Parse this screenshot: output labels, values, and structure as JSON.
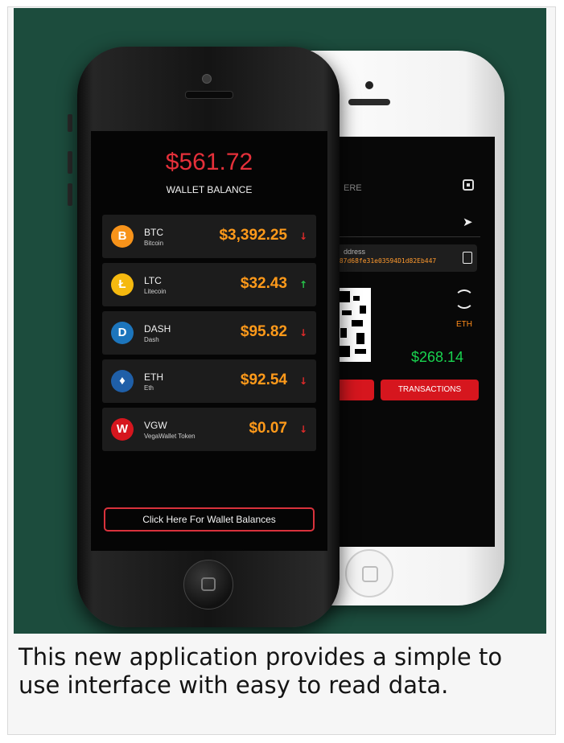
{
  "caption": "This new application provides a simple to use interface with easy to read data.",
  "front_phone": {
    "balance": "$561.72",
    "balance_label": "WALLET BALANCE",
    "coins": [
      {
        "symbol": "BTC",
        "name": "Bitcoin",
        "price": "$3,392.25",
        "trend": "↓",
        "direction": "down",
        "icon": "bitcoin-icon",
        "color": "#f7931a",
        "glyph": "B"
      },
      {
        "symbol": "LTC",
        "name": "Litecoin",
        "price": "$32.43",
        "trend": "↑",
        "direction": "up",
        "icon": "litecoin-icon",
        "color": "#f5b90f",
        "glyph": "Ł"
      },
      {
        "symbol": "DASH",
        "name": "Dash",
        "price": "$95.82",
        "trend": "↓",
        "direction": "down",
        "icon": "dash-icon",
        "color": "#1c75bc",
        "glyph": "D"
      },
      {
        "symbol": "ETH",
        "name": "Eth",
        "price": "$92.54",
        "trend": "↓",
        "direction": "down",
        "icon": "ethereum-icon",
        "color": "#1f5fa8",
        "glyph": "♦"
      },
      {
        "symbol": "VGW",
        "name": "VegaWallet Token",
        "price": "$0.07",
        "trend": "↓",
        "direction": "down",
        "icon": "vegawallet-icon",
        "color": "#d6161e",
        "glyph": "W"
      }
    ],
    "wallet_button": "Click Here For Wallet Balances"
  },
  "back_phone": {
    "scan_label": "ERE",
    "address_label": "ddress",
    "address_value": "a87d68fe31e03594D1d82Eb447",
    "currency": "ETH",
    "amount": "$268.14",
    "transactions_button": "TRANSACTIONS"
  }
}
